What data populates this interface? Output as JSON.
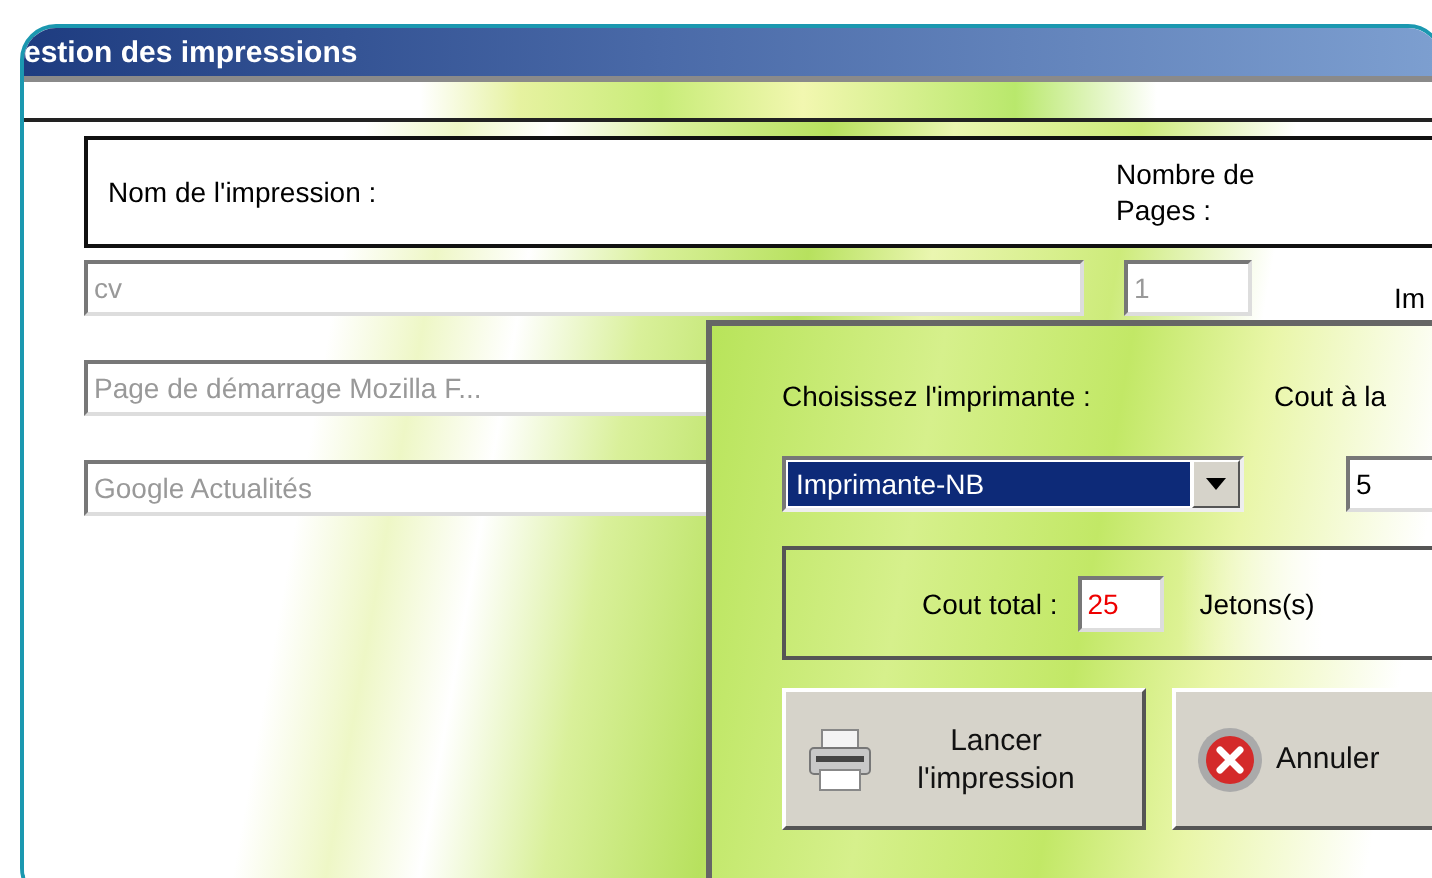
{
  "window": {
    "title": "estion des impressions"
  },
  "table": {
    "columns": [
      "Nom de l'impression :",
      "Nombre de Pages :"
    ]
  },
  "jobs": [
    {
      "name": "cv",
      "pages": "1",
      "column_3": "Im"
    },
    {
      "name": "Page de démarrage Mozilla F..."
    },
    {
      "name": "Google Actualités"
    }
  ],
  "dialog": {
    "printer_label": "Choisissez l'imprimante :",
    "cost_label": "Cout à la",
    "printer": "Imprimante-NB",
    "cost_per_page": "5",
    "total_label": "Cout total :",
    "total": "25",
    "unit": "Jetons(s)",
    "buttons": [
      {
        "kind": "print",
        "label": "Lancer l'impression"
      },
      {
        "kind": "cancel",
        "label": "Annuler"
      }
    ]
  }
}
